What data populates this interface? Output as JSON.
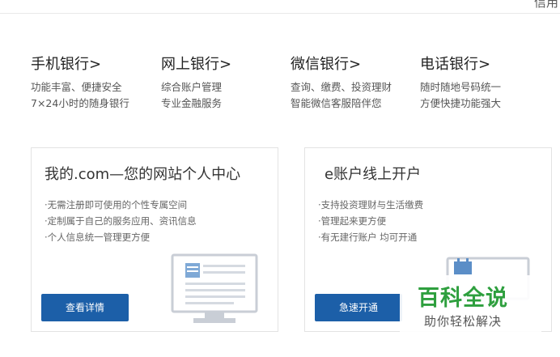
{
  "header": {
    "corner_text": "信用"
  },
  "channels": [
    {
      "title": "手机银行>",
      "lines": [
        "功能丰富、便捷安全",
        "7×24小时的随身银行"
      ]
    },
    {
      "title": "网上银行>",
      "lines": [
        "综合账户管理",
        "专业金融服务"
      ]
    },
    {
      "title": "微信银行>",
      "lines": [
        "查询、缴费、投资理财",
        "智能微信客服陪伴您"
      ]
    },
    {
      "title": "电话银行>",
      "lines": [
        "随时随地号码统一",
        "方便快捷功能强大"
      ]
    }
  ],
  "cards": [
    {
      "title": "我的.com—您的网站个人中心",
      "items": [
        "·无需注册即可使用的个性专属空间",
        "·定制属于自己的服务应用、资讯信息",
        "·个人信息统一管理更方便"
      ],
      "button": "查看详情"
    },
    {
      "title": "e账户线上开户",
      "items": [
        "·支持投资理财与生活缴费",
        "·管理起来更方便",
        "·有无建行账户 均可开通"
      ],
      "button": "急速开通"
    }
  ],
  "watermark": {
    "title": "百科全说",
    "subtitle": "助你轻松解决"
  },
  "colors": {
    "button_blue": "#1c5fa8",
    "watermark_green": "#2e9f3e"
  }
}
